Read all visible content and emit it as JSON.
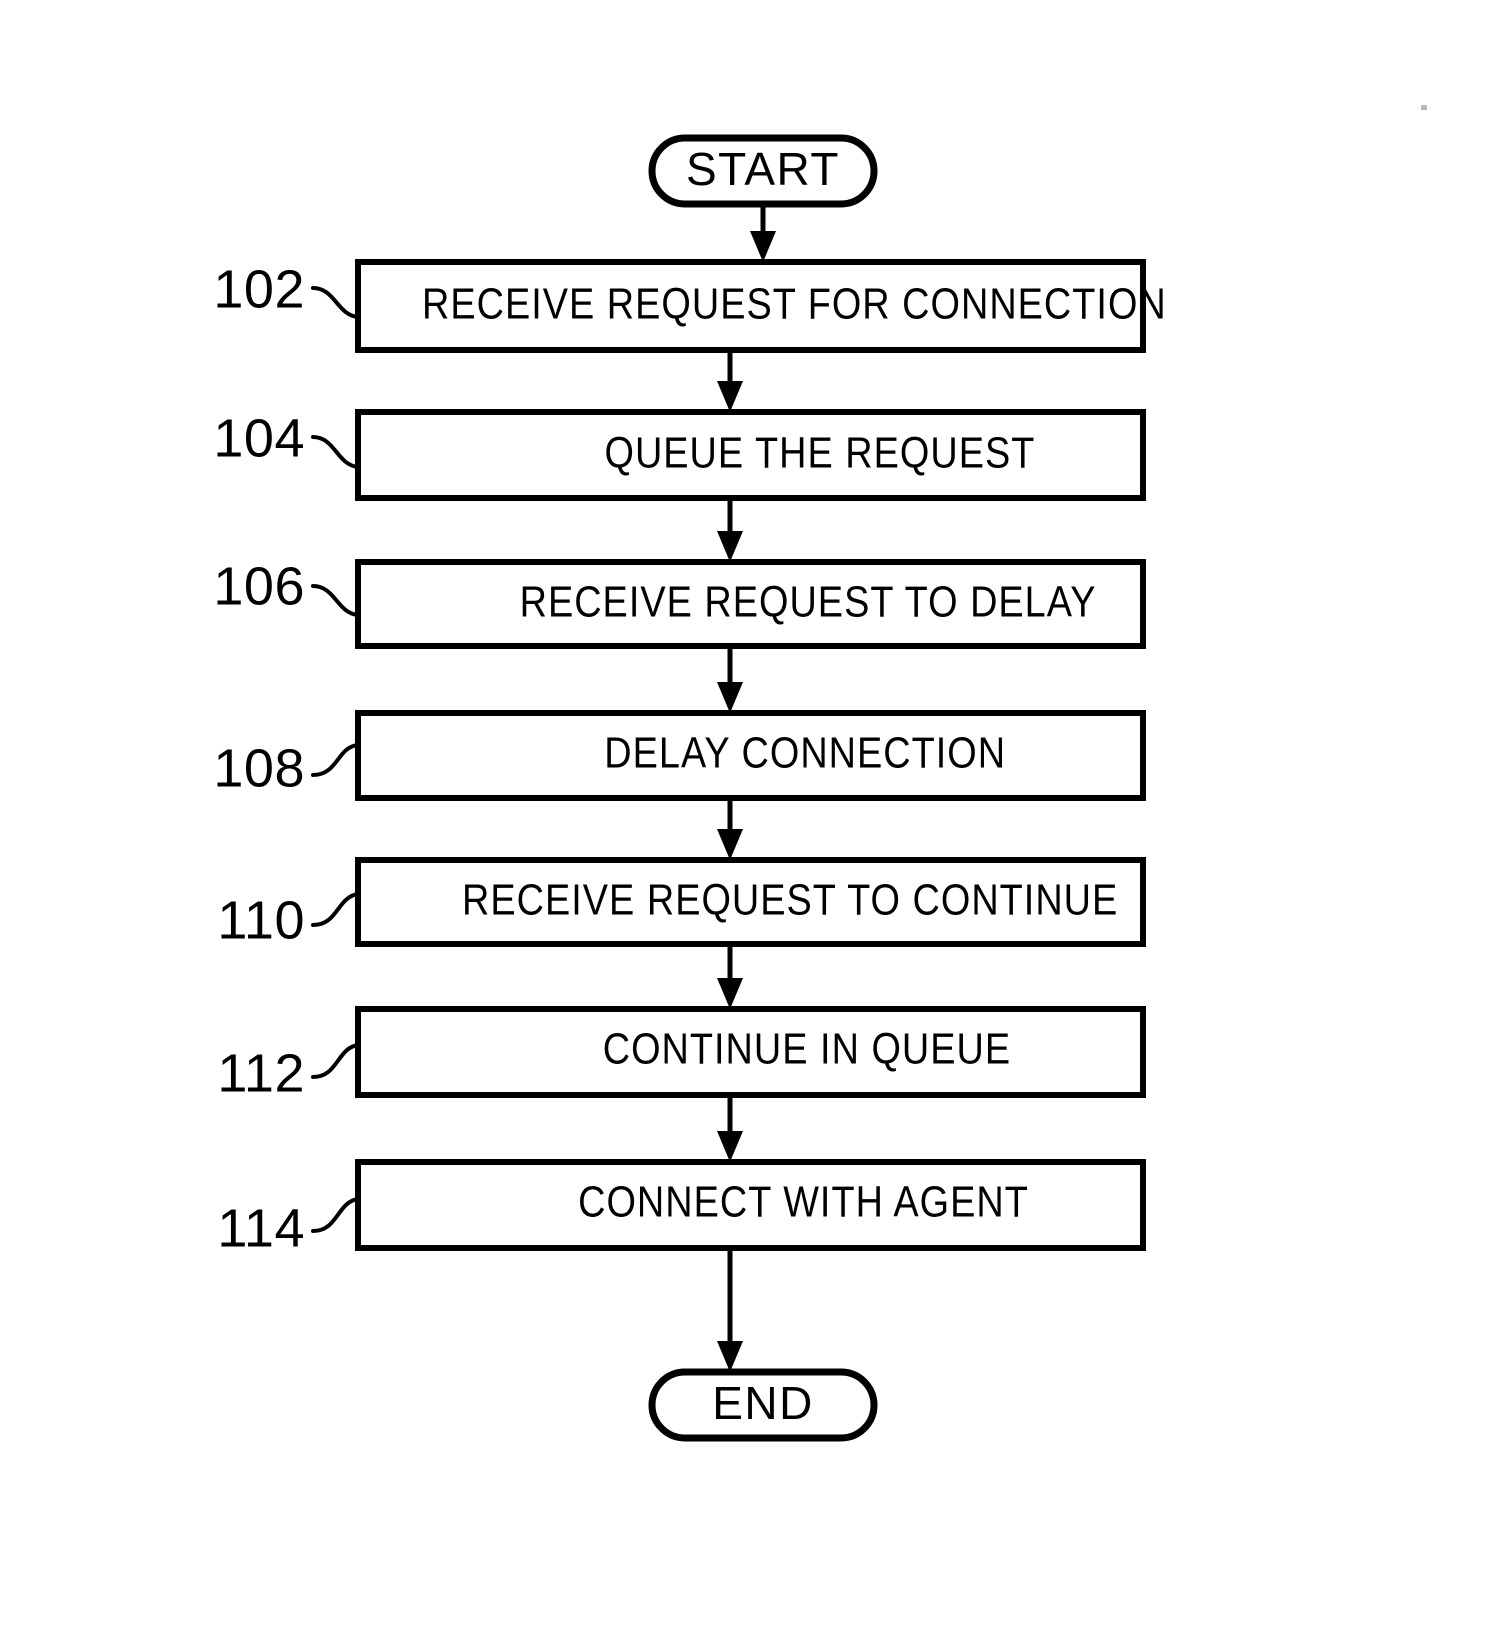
{
  "figure": {
    "type": "flowchart",
    "orientation": "vertical",
    "title": "",
    "background_color": "#ffffff",
    "line_color": "#000000"
  },
  "terminals": {
    "start": {
      "label": "START",
      "shape": "stadium"
    },
    "end": {
      "label": "END",
      "shape": "stadium"
    }
  },
  "steps": [
    {
      "ref": "102",
      "label": "RECEIVE REQUEST FOR CONNECTION"
    },
    {
      "ref": "104",
      "label": "QUEUE THE REQUEST"
    },
    {
      "ref": "106",
      "label": "RECEIVE REQUEST TO DELAY"
    },
    {
      "ref": "108",
      "label": "DELAY CONNECTION"
    },
    {
      "ref": "110",
      "label": "RECEIVE REQUEST TO CONTINUE"
    },
    {
      "ref": "112",
      "label": "CONTINUE IN QUEUE"
    },
    {
      "ref": "114",
      "label": "CONNECT WITH AGENT"
    }
  ],
  "flow_order": [
    "START",
    "102",
    "104",
    "106",
    "108",
    "110",
    "112",
    "114",
    "END"
  ]
}
